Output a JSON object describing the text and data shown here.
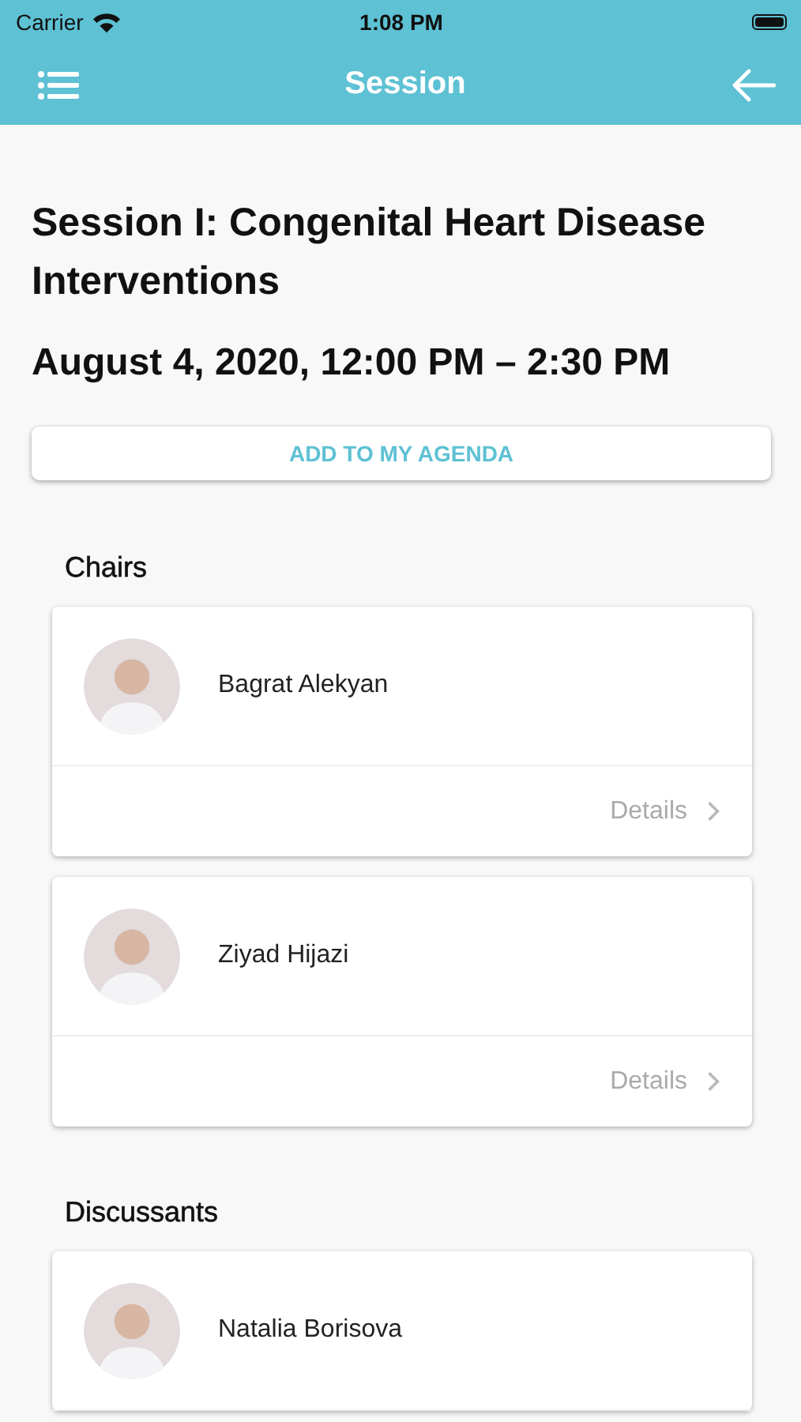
{
  "status_bar": {
    "carrier": "Carrier",
    "time": "1:08 PM"
  },
  "nav": {
    "title": "Session"
  },
  "session": {
    "title": "Session I: Congenital Heart Disease Interventions",
    "datetime": "August 4, 2020, 12:00 PM – 2:30 PM",
    "agenda_button": "ADD TO MY AGENDA"
  },
  "sections": [
    {
      "title": "Chairs",
      "people": [
        {
          "name": "Bagrat Alekyan",
          "details": "Details"
        },
        {
          "name": "Ziyad Hijazi",
          "details": "Details"
        }
      ]
    },
    {
      "title": "Discussants",
      "people": [
        {
          "name": "Natalia Borisova"
        }
      ]
    }
  ]
}
